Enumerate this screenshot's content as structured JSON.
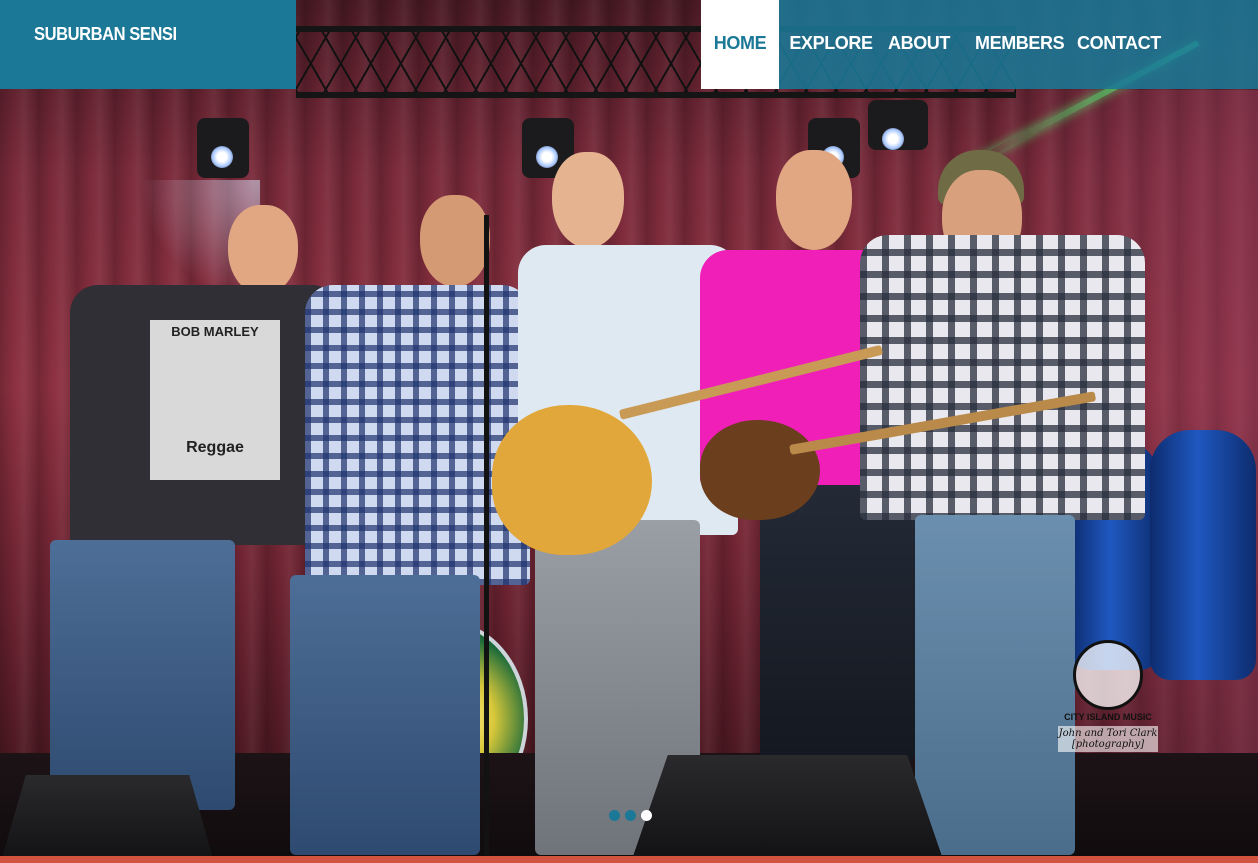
{
  "site": {
    "brand": "SUBURBAN SENSI",
    "accent_color": "#1b7896",
    "bottom_bar_color": "#d2533f"
  },
  "nav": {
    "items": [
      {
        "label": "HOME",
        "active": true
      },
      {
        "label": "EXPLORE",
        "active": false
      },
      {
        "label": "ABOUT",
        "active": false
      },
      {
        "label": "MEMBERS",
        "active": false
      },
      {
        "label": "CONTACT",
        "active": false
      }
    ]
  },
  "hero": {
    "image_alt": "Band photo on stage",
    "shirt_text": "BOB MARLEY",
    "shirt_subtext": "Reggae",
    "watermark_line1": "CITY ISLAND MUSIC",
    "watermark_line2": "John and Tori Clark [photography]"
  },
  "slider": {
    "dots": [
      {
        "active": false
      },
      {
        "active": false
      },
      {
        "active": true
      }
    ]
  }
}
